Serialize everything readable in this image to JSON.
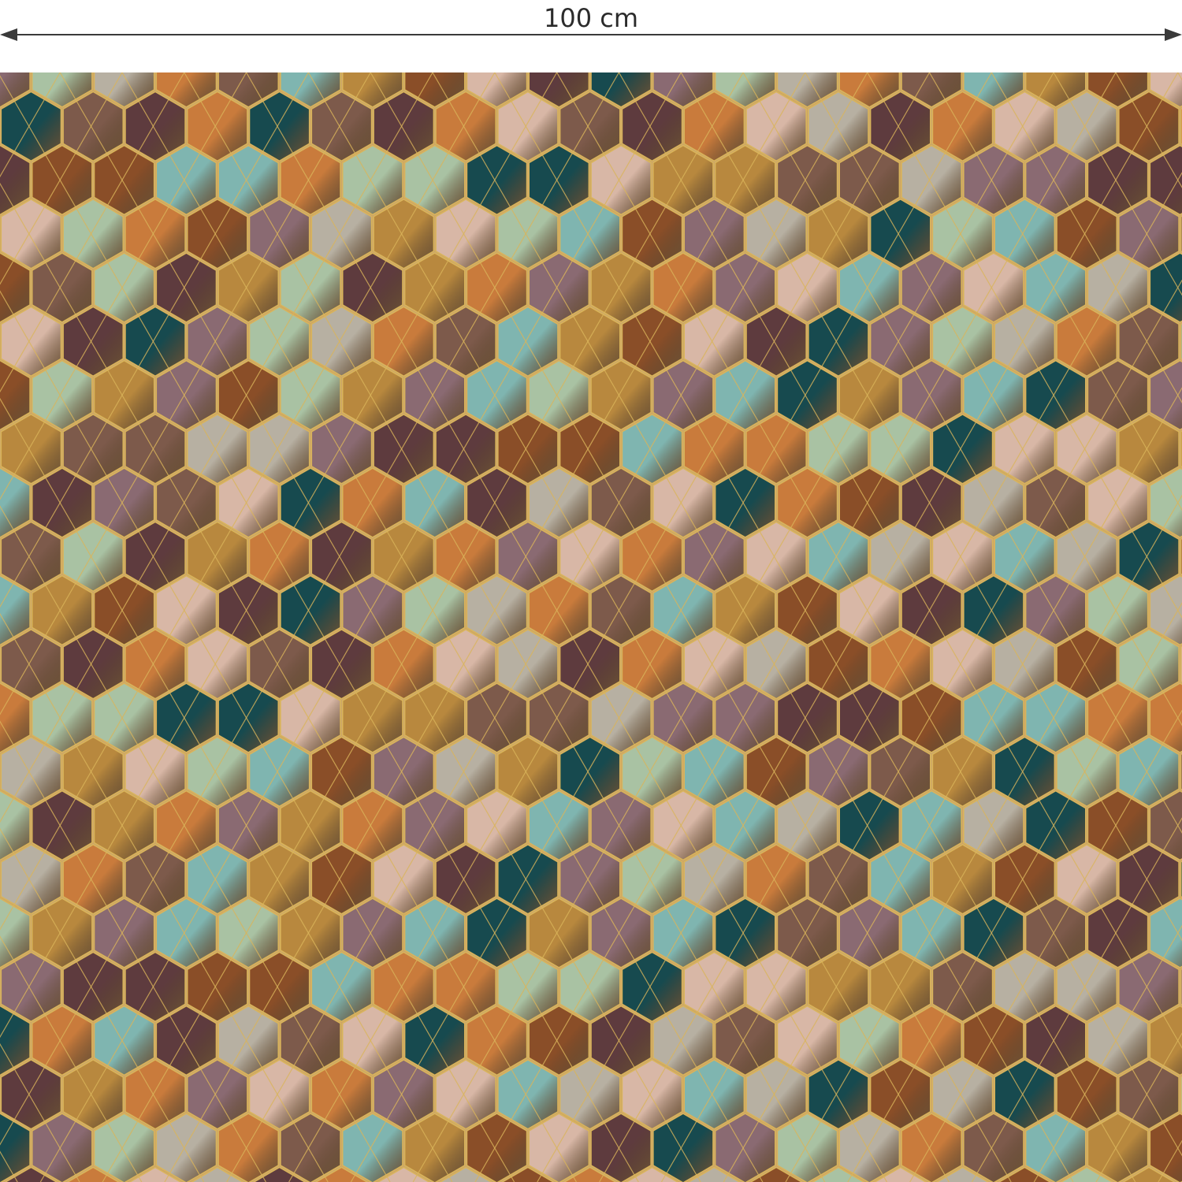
{
  "measurement": {
    "label": "100 cm",
    "arrow_color": "#3a3a3a"
  },
  "pattern": {
    "motif": "hexagon-tiles",
    "grout_color": "#d9b45a",
    "palette": {
      "teal": "#174a4f",
      "copper": "#c97b3c",
      "rust_brown": "#8a4e28",
      "mauve": "#8a6a72",
      "wood_brown": "#7d5a4b",
      "blush": "#d8b7a6",
      "sage": "#a9c2a3",
      "aqua": "#7fb5b0",
      "plum": "#5e3b3e",
      "driftwood": "#b7b0a2",
      "gold": "#b8883e"
    }
  }
}
